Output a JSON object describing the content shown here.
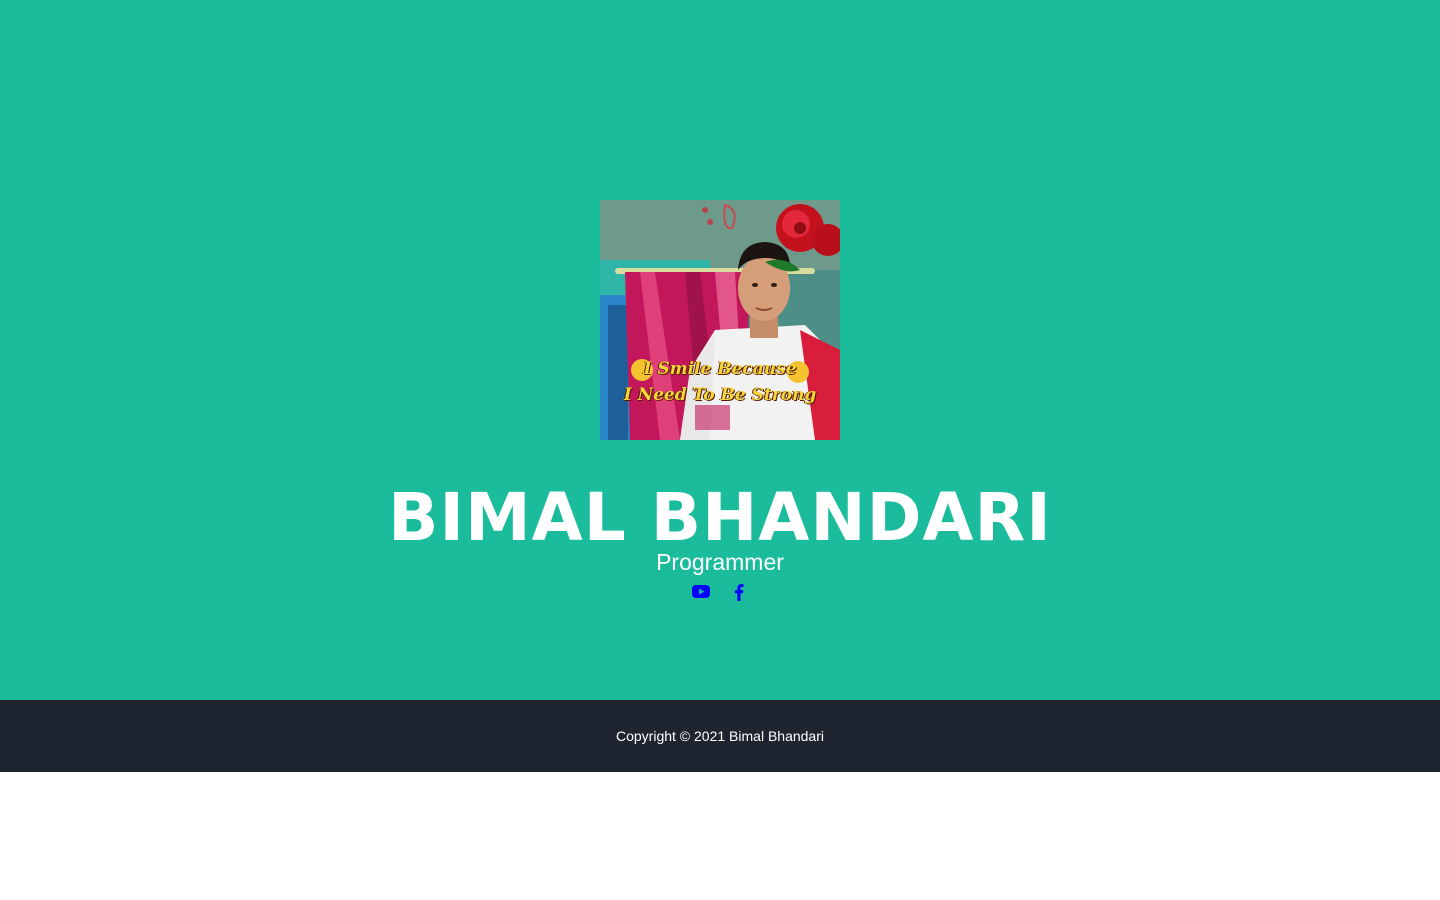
{
  "profile": {
    "name": "BIMAL BHANDARI",
    "role": "Programmer",
    "photo_caption_line1": "I Smile Because",
    "photo_caption_line2": "I Need To Be Strong"
  },
  "social": [
    {
      "icon": "youtube-icon",
      "color": "#0000ff"
    },
    {
      "icon": "facebook-icon",
      "color": "#0000ff"
    }
  ],
  "footer": {
    "copyright": "Copyright © 2021 Bimal Bhandari"
  },
  "colors": {
    "hero_background": "#1abc9c",
    "footer_background": "#1e2530",
    "text": "#ffffff",
    "social_icons": "#0000ff"
  }
}
